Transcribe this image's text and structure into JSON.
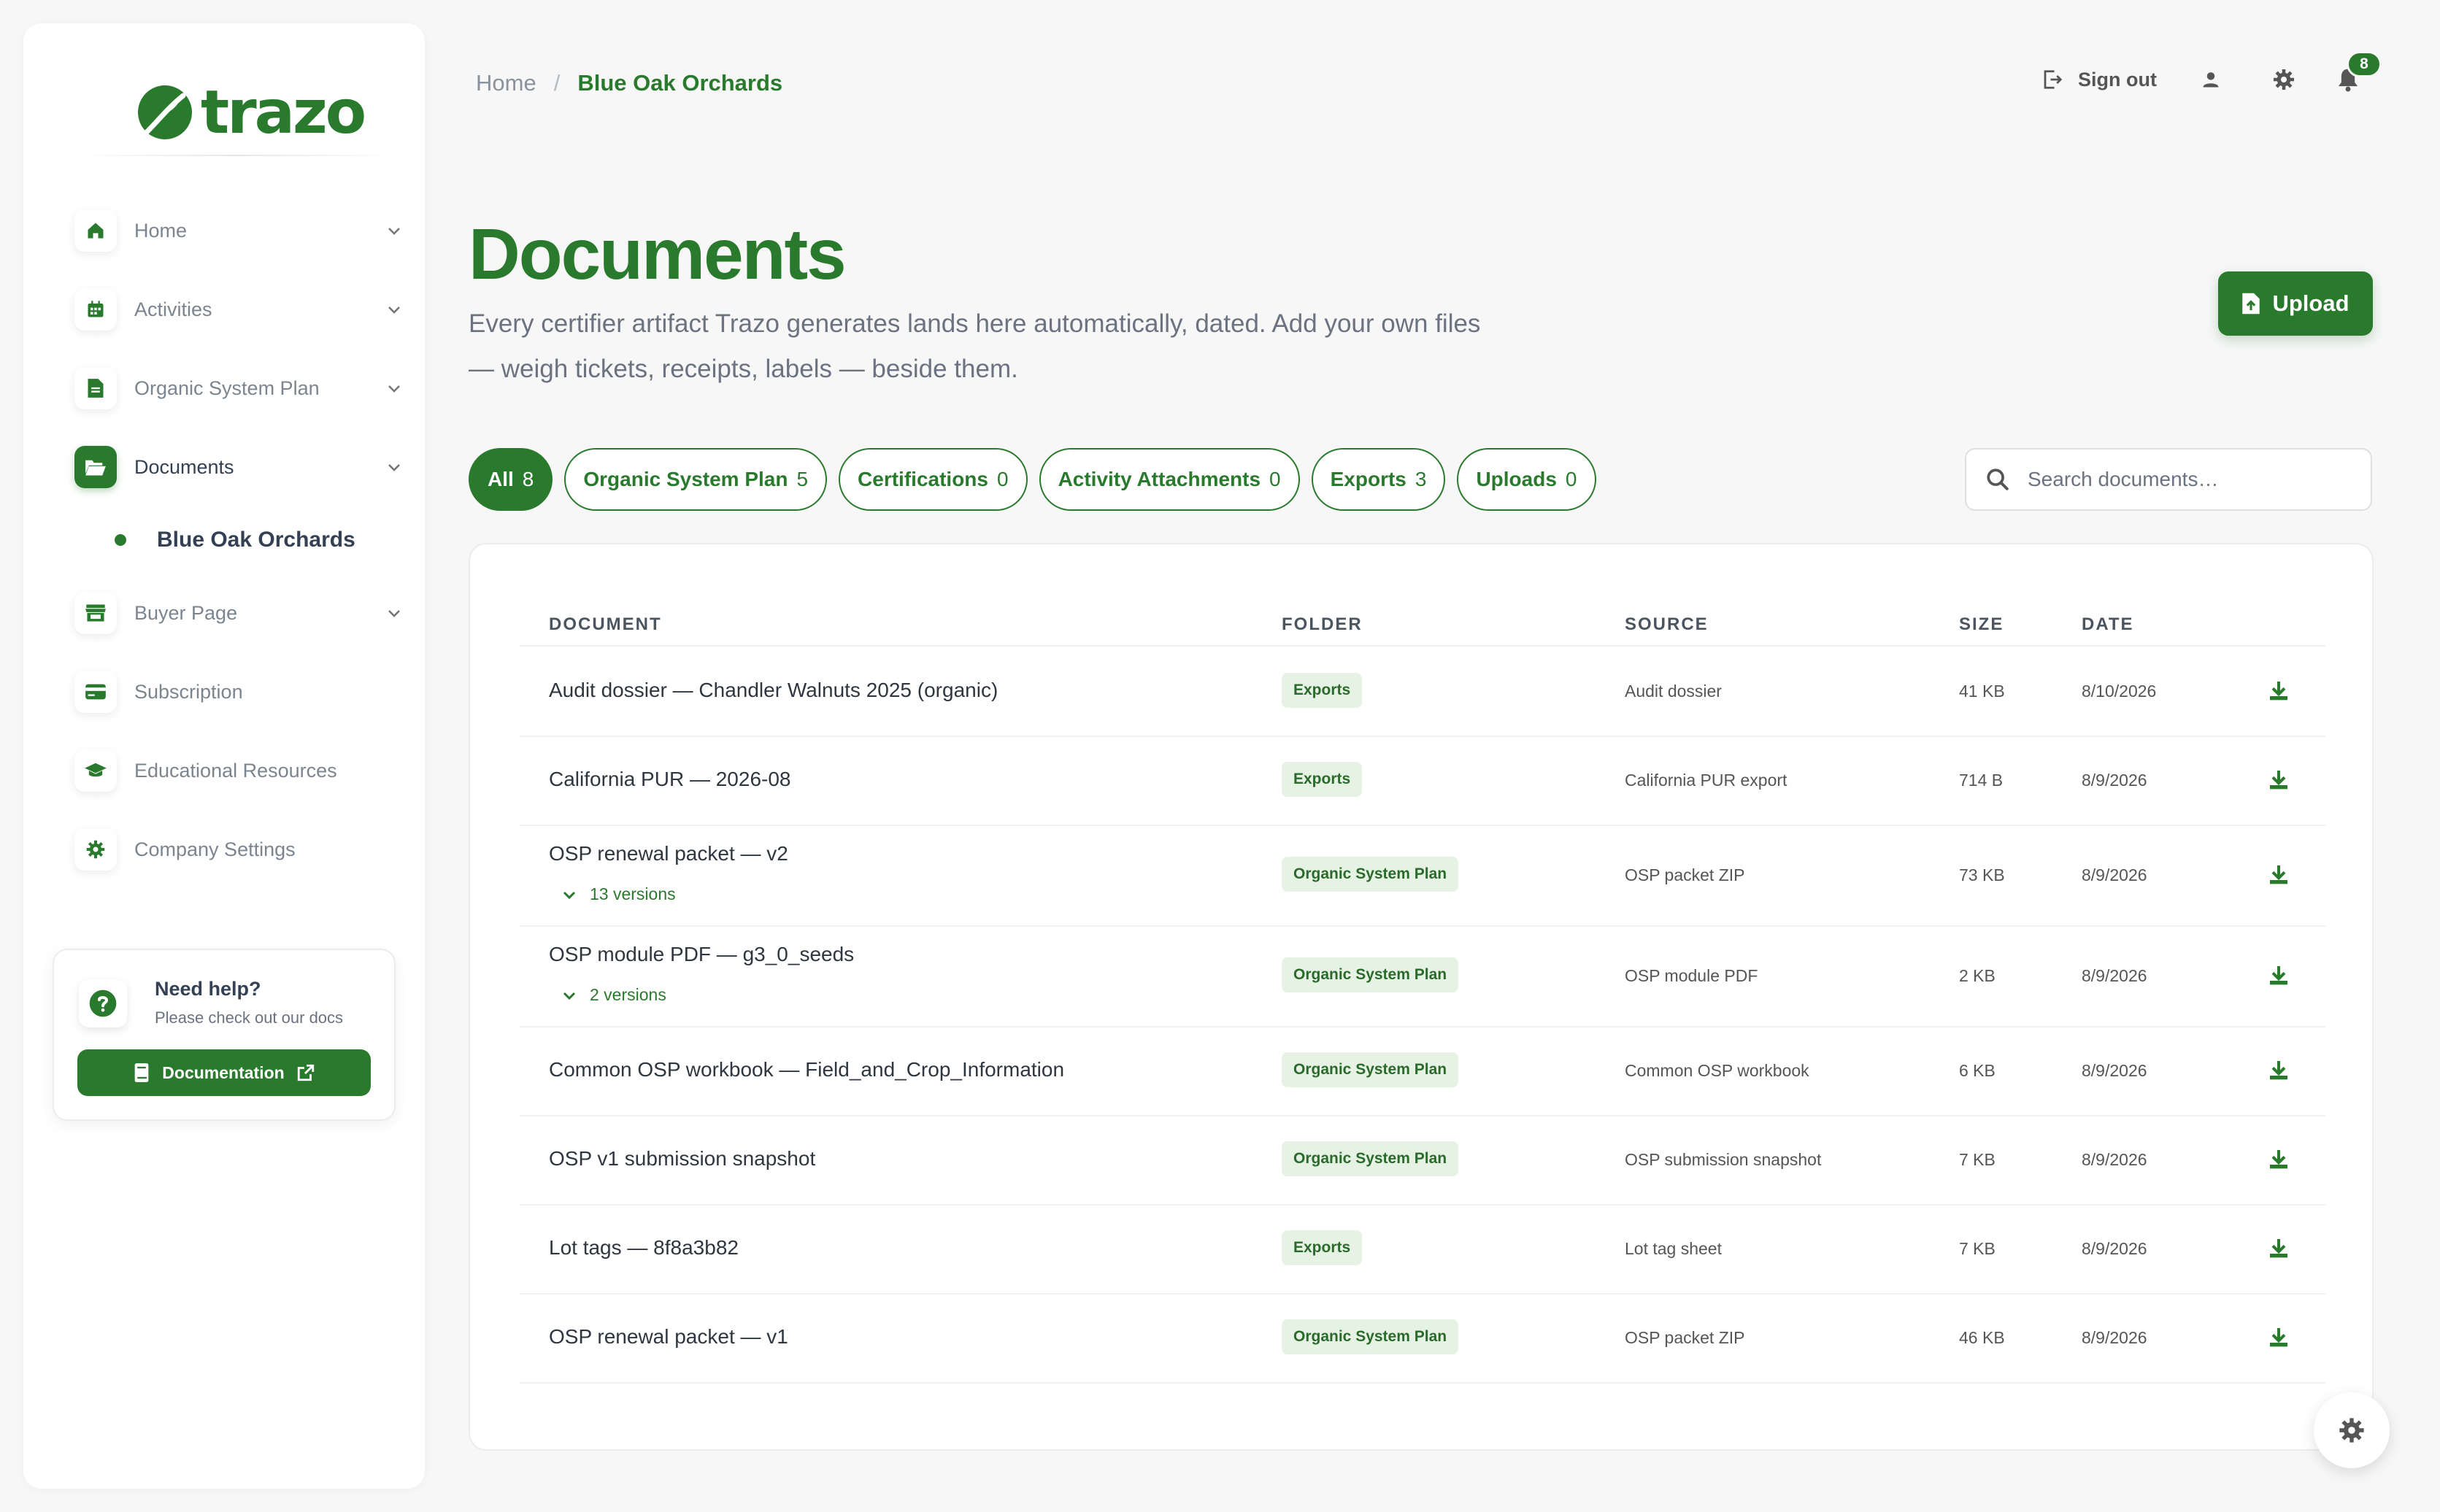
{
  "brand": {
    "name": "trazo",
    "color": "#2a7a2e"
  },
  "sidebar": {
    "items": [
      {
        "label": "Home",
        "icon": "home-icon",
        "expandable": true,
        "active": false
      },
      {
        "label": "Activities",
        "icon": "calendar-icon",
        "expandable": true,
        "active": false
      },
      {
        "label": "Organic System Plan",
        "icon": "document-icon",
        "expandable": true,
        "active": false
      },
      {
        "label": "Documents",
        "icon": "folder-open-icon",
        "expandable": true,
        "active": true
      },
      {
        "label": "Buyer Page",
        "icon": "store-icon",
        "expandable": true,
        "active": false
      },
      {
        "label": "Subscription",
        "icon": "credit-card-icon",
        "expandable": false,
        "active": false
      },
      {
        "label": "Educational Resources",
        "icon": "graduation-cap-icon",
        "expandable": false,
        "active": false
      },
      {
        "label": "Company Settings",
        "icon": "gear-icon",
        "expandable": false,
        "active": false
      }
    ],
    "sub_item": {
      "label": "Blue Oak Orchards"
    },
    "help": {
      "title": "Need help?",
      "subtitle": "Please check out our docs",
      "button_label": "Documentation"
    }
  },
  "breadcrumb": {
    "home": "Home",
    "separator": "/",
    "current": "Blue Oak Orchards"
  },
  "topbar": {
    "sign_out": "Sign out",
    "notification_count": "8"
  },
  "page": {
    "title": "Documents",
    "description": "Every certifier artifact Trazo generates lands here automatically, dated. Add your own files — weigh tickets, receipts, labels — beside them.",
    "upload_label": "Upload"
  },
  "filters": [
    {
      "label": "All",
      "count": "8",
      "active": true
    },
    {
      "label": "Organic System Plan",
      "count": "5",
      "active": false
    },
    {
      "label": "Certifications",
      "count": "0",
      "active": false
    },
    {
      "label": "Activity Attachments",
      "count": "0",
      "active": false
    },
    {
      "label": "Exports",
      "count": "3",
      "active": false
    },
    {
      "label": "Uploads",
      "count": "0",
      "active": false
    }
  ],
  "search": {
    "placeholder": "Search documents…"
  },
  "table": {
    "headers": {
      "document": "DOCUMENT",
      "folder": "FOLDER",
      "source": "SOURCE",
      "size": "SIZE",
      "date": "DATE"
    },
    "rows": [
      {
        "document": "Audit dossier — Chandler Walnuts 2025 (organic)",
        "folder": "Exports",
        "source": "Audit dossier",
        "size": "41 KB",
        "date": "8/10/2026",
        "versions": ""
      },
      {
        "document": "California PUR — 2026-08",
        "folder": "Exports",
        "source": "California PUR export",
        "size": "714 B",
        "date": "8/9/2026",
        "versions": ""
      },
      {
        "document": "OSP renewal packet — v2",
        "folder": "Organic System Plan",
        "source": "OSP packet ZIP",
        "size": "73 KB",
        "date": "8/9/2026",
        "versions": "13 versions"
      },
      {
        "document": "OSP module PDF — g3_0_seeds",
        "folder": "Organic System Plan",
        "source": "OSP module PDF",
        "size": "2 KB",
        "date": "8/9/2026",
        "versions": "2 versions"
      },
      {
        "document": "Common OSP workbook — Field_and_Crop_Information",
        "folder": "Organic System Plan",
        "source": "Common OSP workbook",
        "size": "6 KB",
        "date": "8/9/2026",
        "versions": ""
      },
      {
        "document": "OSP v1 submission snapshot",
        "folder": "Organic System Plan",
        "source": "OSP submission snapshot",
        "size": "7 KB",
        "date": "8/9/2026",
        "versions": ""
      },
      {
        "document": "Lot tags — 8f8a3b82",
        "folder": "Exports",
        "source": "Lot tag sheet",
        "size": "7 KB",
        "date": "8/9/2026",
        "versions": ""
      },
      {
        "document": "OSP renewal packet — v1",
        "folder": "Organic System Plan",
        "source": "OSP packet ZIP",
        "size": "46 KB",
        "date": "8/9/2026",
        "versions": ""
      }
    ]
  }
}
